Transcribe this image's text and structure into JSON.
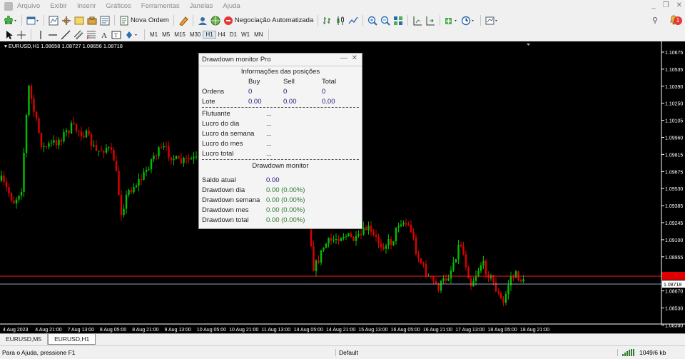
{
  "menu": [
    "Arquivo",
    "Exibir",
    "Inserir",
    "Gráficos",
    "Ferramentas",
    "Janelas",
    "Ajuda"
  ],
  "toolbar": {
    "new_order_label": "Nova Ordem",
    "algo_trading_label": "Negociação Automatizada",
    "notification_count": "1",
    "timeframes": [
      "M1",
      "M5",
      "M15",
      "M30",
      "H1",
      "H4",
      "D1",
      "W1",
      "MN"
    ],
    "active_timeframe": "H1"
  },
  "chart": {
    "header": "EURUSD,H1  1.08658 1.08727 1.08656 1.08718",
    "current_price": "1.08718",
    "background": "#000000",
    "bull_color": "#00c000",
    "bear_color": "#e00000",
    "price_axis": [
      "1.10675",
      "1.10535",
      "1.10390",
      "1.10250",
      "1.10105",
      "1.09960",
      "1.09815",
      "1.09675",
      "1.09530",
      "1.09385",
      "1.09245",
      "1.09100",
      "1.08955",
      "1.08815",
      "1.08670",
      "1.08530",
      "1.08390"
    ],
    "time_axis": [
      "4 Aug 2023",
      "4 Aug 21:00",
      "7 Aug 13:00",
      "8 Aug 05:00",
      "8 Aug 21:00",
      "9 Aug 13:00",
      "10 Aug 05:00",
      "10 Aug 21:00",
      "11 Aug 13:00",
      "14 Aug 05:00",
      "14 Aug 21:00",
      "15 Aug 13:00",
      "16 Aug 05:00",
      "16 Aug 21:00",
      "17 Aug 13:00",
      "18 Aug 05:00",
      "18 Aug 21:00"
    ]
  },
  "tabs": [
    "EURUSD,M5",
    "EURUSD,H1"
  ],
  "active_tab": "EURUSD,H1",
  "status": {
    "help": "Para o Ajuda, pressione F1",
    "profile": "Default",
    "traffic": "1049/6 kb"
  },
  "panel": {
    "title": "Drawdown monitor Pro",
    "positions_title": "Informações das posições",
    "columns": [
      "Buy",
      "Sell",
      "Total"
    ],
    "rows": [
      {
        "label": "Ordens",
        "buy": "0",
        "sell": "0",
        "total": "0"
      },
      {
        "label": "Lote",
        "buy": "0.00",
        "sell": "0.00",
        "total": "0.00"
      }
    ],
    "profit_rows": [
      {
        "label": "Flutuante",
        "value": "..."
      },
      {
        "label": "Lucro do dia",
        "value": "..."
      },
      {
        "label": "Lucro da semana",
        "value": "..."
      },
      {
        "label": "Lucro do mes",
        "value": "..."
      },
      {
        "label": "Lucro total",
        "value": "..."
      }
    ],
    "drawdown_title": "Drawdown monitor",
    "balance_label": "Saldo atual",
    "balance_value": "0.00",
    "drawdown_rows": [
      {
        "label": "Drawdown dia",
        "value": "0.00 (0.00%)"
      },
      {
        "label": "Drawdown semana",
        "value": "0.00 (0.00%)"
      },
      {
        "label": "Drawdown mes",
        "value": "0.00 (0.00%)"
      },
      {
        "label": "Drawdown total",
        "value": "0.00 (0.00%)"
      }
    ]
  }
}
